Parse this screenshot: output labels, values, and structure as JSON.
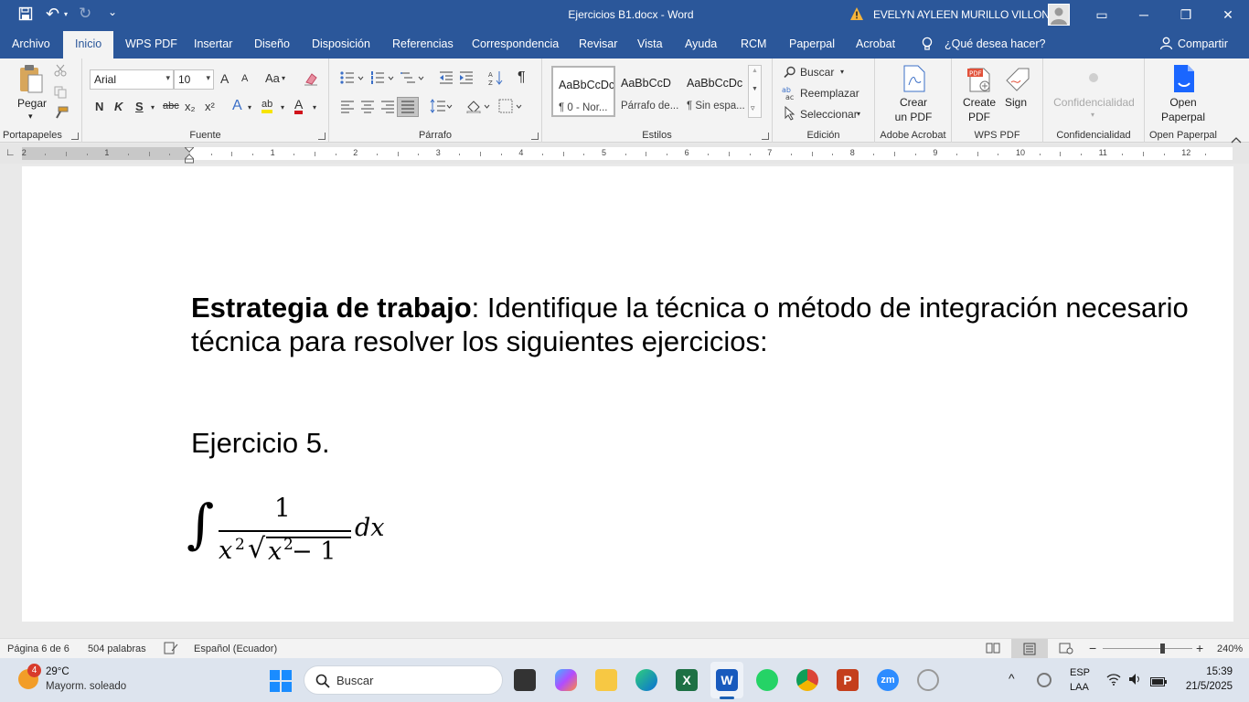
{
  "titlebar": {
    "title": "Ejercicios B1.docx  -  Word",
    "user": "EVELYN AYLEEN MURILLO VILLON",
    "save_glyph": "💾",
    "undo_glyph": "↶",
    "redo_glyph": "↻",
    "customize_glyph": "⌄",
    "ribbon_display_glyph": "▭",
    "minimize_glyph": "─",
    "restore_glyph": "❐",
    "close_glyph": "✕"
  },
  "tabs": [
    {
      "label": "Archivo"
    },
    {
      "label": "Inicio"
    },
    {
      "label": "WPS PDF"
    },
    {
      "label": "Insertar"
    },
    {
      "label": "Diseño"
    },
    {
      "label": "Disposición"
    },
    {
      "label": "Referencias"
    },
    {
      "label": "Correspondencia"
    },
    {
      "label": "Revisar"
    },
    {
      "label": "Vista"
    },
    {
      "label": "Ayuda"
    },
    {
      "label": "RCM"
    },
    {
      "label": "Paperpal"
    },
    {
      "label": "Acrobat"
    }
  ],
  "tell_me": "¿Qué desea hacer?",
  "share": "Compartir",
  "ribbon": {
    "clipboard": {
      "paste": "Pegar",
      "label": "Portapapeles"
    },
    "font": {
      "name": "Arial",
      "size": "10",
      "label": "Fuente",
      "grow": "A",
      "shrink": "A",
      "case": "Aa",
      "bold": "N",
      "italic": "K",
      "underline": "S",
      "strike": "abc",
      "subscript": "x₂",
      "superscript": "x²",
      "effects": "A",
      "highlight": "ab",
      "color": "A"
    },
    "paragraph": {
      "label": "Párrafo",
      "pilcrow": "¶"
    },
    "styles": {
      "label": "Estilos",
      "items": [
        {
          "preview": "AaBbCcDc",
          "name": "¶ 0 - Nor..."
        },
        {
          "preview": "AaBbCcD",
          "name": "Párrafo de..."
        },
        {
          "preview": "AaBbCcDc",
          "name": "¶ Sin espa..."
        }
      ]
    },
    "editing": {
      "find": "Buscar",
      "replace": "Reemplazar",
      "select": "Seleccionar",
      "label": "Edición"
    },
    "acrobat": {
      "create_l1": "Crear",
      "create_l2": "un PDF",
      "label": "Adobe Acrobat"
    },
    "wps": {
      "create_l1": "Create",
      "create_l2": "PDF",
      "sign": "Sign",
      "label": "WPS PDF",
      "pdf_tag": "PDF"
    },
    "confidential": {
      "button": "Confidencialidad",
      "label": "Confidencialidad"
    },
    "paperpal": {
      "open_l1": "Open",
      "open_l2": "Paperpal",
      "label": "Open Paperpal"
    }
  },
  "ruler": {
    "numbers": [
      "2",
      "1",
      "1",
      "2",
      "3",
      "4",
      "5",
      "6",
      "7",
      "8",
      "9",
      "10",
      "11",
      "12"
    ],
    "tab_marker": "∟"
  },
  "document": {
    "strategy_bold": "Estrategia de trabajo",
    "strategy_rest": ": Identifique la técnica o método de integración necesario",
    "strategy_line2": "técnica para resolver los siguientes ejercicios:",
    "exercise": "Ejercicio 5.",
    "integral": {
      "symbol": "∫",
      "numerator": "1",
      "den_x": "x",
      "den_exp": "2",
      "sqrt": "√",
      "rad_x": "x",
      "rad_exp": "2",
      "rad_minus": " − 1",
      "dx": "dx"
    }
  },
  "statusbar": {
    "page": "Página 6 de 6",
    "words": "504 palabras",
    "language": "Español (Ecuador)",
    "zoom": "240%",
    "zoom_minus": "−",
    "zoom_plus": "+"
  },
  "taskbar": {
    "weather_temp": "29°C",
    "weather_desc": "Mayorm. soleado",
    "weather_badge": "4",
    "search": "Buscar",
    "excel_letter": "X",
    "word_letter": "W",
    "ppt_letter": "P",
    "zoom_letters": "zm",
    "lang_l1": "ESP",
    "lang_l2": "LAA",
    "time": "15:39",
    "date": "21/5/2025",
    "chevron": "^"
  },
  "colors": {
    "word_blue": "#2b579a",
    "ribbon_bg": "#f3f3f3",
    "taskbar_bg": "#dde4ee",
    "page_bg": "#ffffff"
  }
}
